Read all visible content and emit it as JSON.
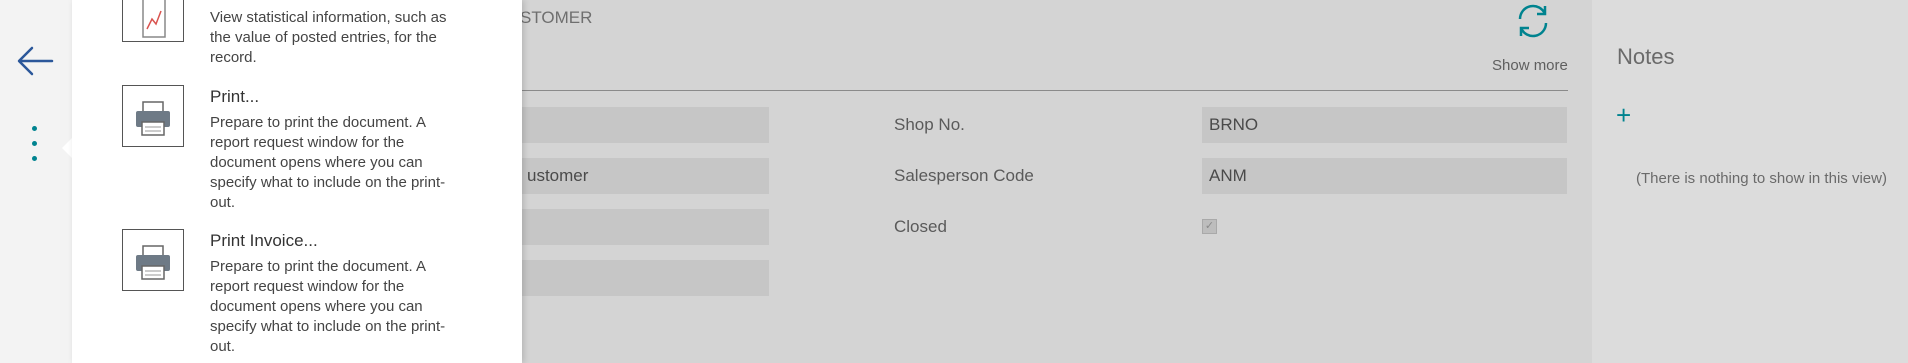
{
  "nav": {
    "back_icon": "arrow-left-icon",
    "more_icon": "vertical-ellipsis-icon"
  },
  "card": {
    "header_fragment": "STOMER",
    "show_more": "Show more",
    "fields": {
      "left2_value": "ustomer",
      "shop_no_label": "Shop No.",
      "shop_no_value": "BRNO",
      "salesperson_label": "Salesperson Code",
      "salesperson_value": "ANM",
      "closed_label": "Closed",
      "closed_checked": true
    }
  },
  "notes": {
    "title": "Notes",
    "add_symbol": "+",
    "empty": "(There is nothing to show in this view)"
  },
  "menu": {
    "items": [
      {
        "title": "",
        "desc": "View statistical information, such as the value of posted entries, for the record.",
        "icon": "statistics-chart-icon"
      },
      {
        "title": "Print...",
        "desc": "Prepare to print the document. A report request window for the document opens where you can specify what to include on the print-out.",
        "icon": "printer-icon"
      },
      {
        "title": "Print Invoice...",
        "desc": "Prepare to print the document. A report request window for the document opens where you can specify what to include on the print-out.",
        "icon": "printer-icon"
      }
    ]
  },
  "colors": {
    "accent": "#00838f",
    "overlay_bg": "#d4d4d4"
  }
}
